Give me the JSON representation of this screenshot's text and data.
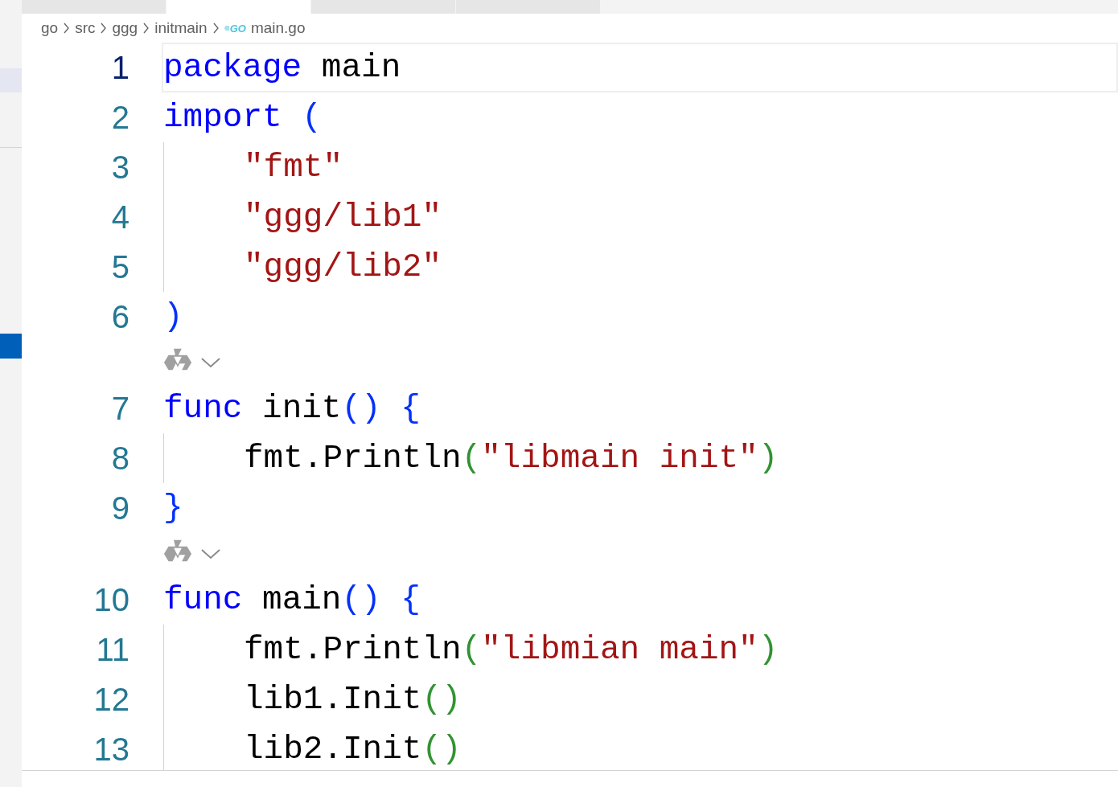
{
  "tabs": [
    {
      "selected": false
    },
    {
      "selected": true
    },
    {
      "selected": false
    },
    {
      "selected": false
    }
  ],
  "sidebar_edge": {
    "items": [
      {
        "kind": "hover-row"
      },
      {
        "kind": "focused-row"
      }
    ]
  },
  "breadcrumb": {
    "folders": [
      "go",
      "src",
      "ggg",
      "initmain"
    ],
    "file_icon": "GO",
    "file": "main.go"
  },
  "editor": {
    "lines": [
      {
        "kind": "code",
        "number": "1",
        "active": true,
        "indent": false,
        "tokens": [
          {
            "kind": "keyword",
            "text": "package"
          },
          {
            "kind": "ident",
            "text": " main"
          }
        ]
      },
      {
        "kind": "code",
        "number": "2",
        "active": false,
        "indent": false,
        "tokens": [
          {
            "kind": "keyword",
            "text": "import"
          },
          {
            "kind": "bracket-1",
            "text": " ("
          }
        ]
      },
      {
        "kind": "code",
        "number": "3",
        "active": false,
        "indent": true,
        "tokens": [
          {
            "kind": "string",
            "text": "\"fmt\""
          }
        ]
      },
      {
        "kind": "code",
        "number": "4",
        "active": false,
        "indent": true,
        "tokens": [
          {
            "kind": "string",
            "text": "\"ggg/lib1\""
          }
        ]
      },
      {
        "kind": "code",
        "number": "5",
        "active": false,
        "indent": true,
        "tokens": [
          {
            "kind": "string",
            "text": "\"ggg/lib2\""
          }
        ]
      },
      {
        "kind": "code",
        "number": "6",
        "active": false,
        "indent": false,
        "tokens": [
          {
            "kind": "bracket-1",
            "text": ")"
          }
        ]
      },
      {
        "kind": "codelens"
      },
      {
        "kind": "code",
        "number": "7",
        "active": false,
        "indent": false,
        "tokens": [
          {
            "kind": "keyword",
            "text": "func"
          },
          {
            "kind": "ident",
            "text": " init"
          },
          {
            "kind": "bracket-1",
            "text": "()"
          },
          {
            "kind": "bracket-1",
            "text": " {"
          }
        ]
      },
      {
        "kind": "code",
        "number": "8",
        "active": false,
        "indent": true,
        "tokens": [
          {
            "kind": "ident",
            "text": "fmt.Println"
          },
          {
            "kind": "bracket-2",
            "text": "("
          },
          {
            "kind": "string",
            "text": "\"libmain init\""
          },
          {
            "kind": "bracket-2",
            "text": ")"
          }
        ]
      },
      {
        "kind": "code",
        "number": "9",
        "active": false,
        "indent": false,
        "tokens": [
          {
            "kind": "bracket-1",
            "text": "}"
          }
        ]
      },
      {
        "kind": "codelens"
      },
      {
        "kind": "code",
        "number": "10",
        "active": false,
        "indent": false,
        "tokens": [
          {
            "kind": "keyword",
            "text": "func"
          },
          {
            "kind": "ident",
            "text": " main"
          },
          {
            "kind": "bracket-1",
            "text": "()"
          },
          {
            "kind": "bracket-1",
            "text": " {"
          }
        ]
      },
      {
        "kind": "code",
        "number": "11",
        "active": false,
        "indent": true,
        "tokens": [
          {
            "kind": "ident",
            "text": "fmt.Println"
          },
          {
            "kind": "bracket-2",
            "text": "("
          },
          {
            "kind": "string",
            "text": "\"libmian main\""
          },
          {
            "kind": "bracket-2",
            "text": ")"
          }
        ]
      },
      {
        "kind": "code",
        "number": "12",
        "active": false,
        "indent": true,
        "tokens": [
          {
            "kind": "ident",
            "text": "lib1.Init"
          },
          {
            "kind": "bracket-2",
            "text": "()"
          }
        ]
      },
      {
        "kind": "code",
        "number": "13",
        "active": false,
        "indent": true,
        "tokens": [
          {
            "kind": "ident",
            "text": "lib2.Init"
          },
          {
            "kind": "bracket-2",
            "text": "()"
          }
        ]
      }
    ]
  }
}
